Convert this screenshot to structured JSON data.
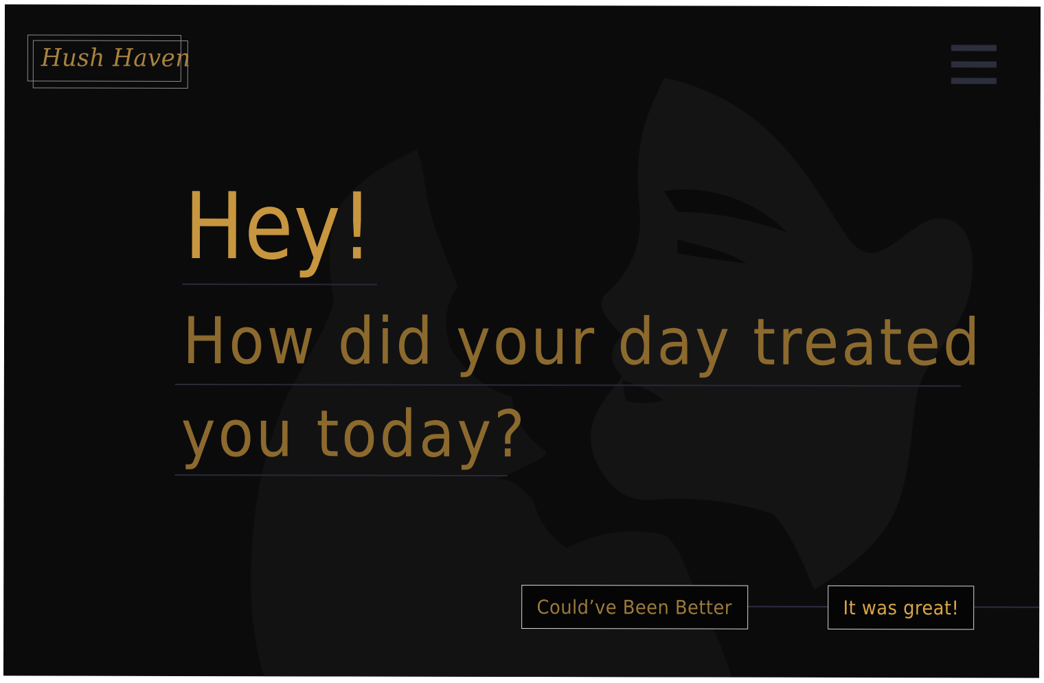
{
  "brand": {
    "logo_text": "Hush Haven"
  },
  "nav": {
    "menu_icon": "hamburger-menu-icon"
  },
  "hero": {
    "greeting": "Hey!",
    "question_line1": "How did your day treated",
    "question_line2": "you today?"
  },
  "choices": {
    "not_good_label": "Could’ve Been Better",
    "good_label": "It was great!"
  },
  "colors": {
    "background": "#0b0b0c",
    "silhouette": "#151516",
    "greeting_gold": "#c7963f",
    "question_gold": "#8c6a2e",
    "button_text_muted": "#9c7a3a",
    "button_text_bright": "#d9a547",
    "menu_bars": "#2c2d3d",
    "rule_lines": "#2a2a38"
  }
}
